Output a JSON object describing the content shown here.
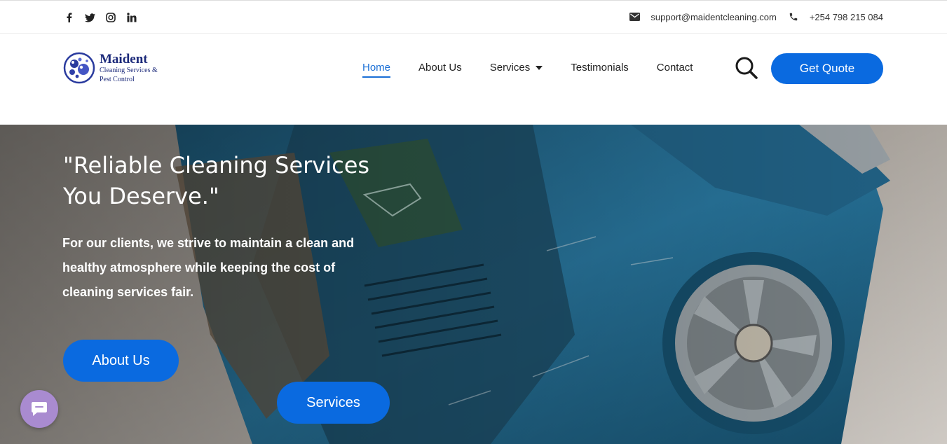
{
  "topbar": {
    "social": [
      "facebook-icon",
      "twitter-icon",
      "instagram-icon",
      "linkedin-icon"
    ],
    "email": "support@maidentcleaning.com",
    "phone": "+254 798 215 084"
  },
  "logo": {
    "title": "Maident",
    "subtitle_line1": "Cleaning Services &",
    "subtitle_line2": "Pest Control"
  },
  "nav": {
    "items": [
      {
        "label": "Home",
        "active": true
      },
      {
        "label": "About Us"
      },
      {
        "label": "Services",
        "has_dropdown": true
      },
      {
        "label": "Testimonials"
      },
      {
        "label": "Contact"
      }
    ],
    "quote_label": "Get Quote"
  },
  "hero": {
    "title": "\"Reliable Cleaning Services You Deserve.\"",
    "text": " For our clients, we strive to maintain a clean and healthy atmosphere while keeping the cost of cleaning services fair.",
    "about_label": "About Us",
    "services_label": "Services"
  },
  "colors": {
    "accent": "#0a6ae0",
    "nav_active": "#1a6fd6",
    "chat_bubble": "#a98bd0",
    "logo_navy": "#1c2a7a"
  },
  "icons": {
    "email": "envelope-icon",
    "phone": "phone-icon",
    "search": "search-icon",
    "chat": "chat-icon"
  }
}
